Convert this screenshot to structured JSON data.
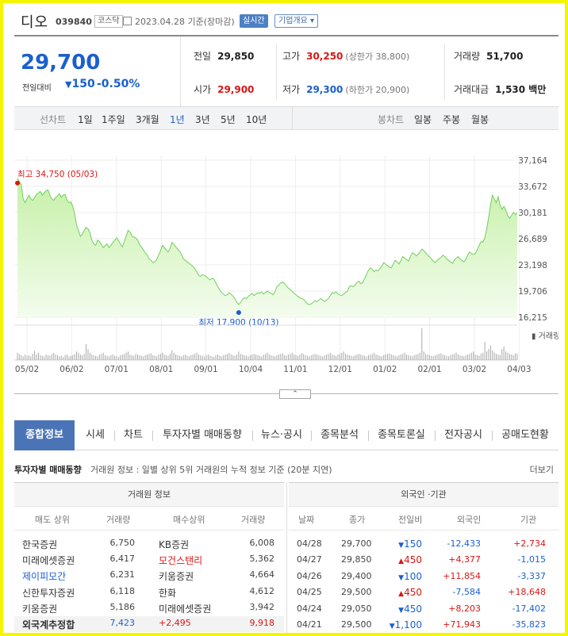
{
  "header": {
    "name": "디오",
    "code": "039840",
    "market": "코스닥",
    "date": "2023.04.28 기준(장마감)",
    "realtime_label": "실시간",
    "company_label": "기업개요"
  },
  "price": {
    "current": "29,700",
    "change_label": "전일대비",
    "change": "150",
    "change_pct": "-0.50%"
  },
  "stats": {
    "prev_label": "전일",
    "prev": "29,850",
    "high_label": "고가",
    "high": "30,250",
    "upper_limit": "(상한가 38,800)",
    "volume_label": "거래량",
    "volume": "51,700",
    "open_label": "시가",
    "open": "29,900",
    "low_label": "저가",
    "low": "29,300",
    "lower_limit": "(하한가 20,900)",
    "value_label": "거래대금",
    "value": "1,530 백만"
  },
  "chart_toolbar": {
    "line_label": "선차트",
    "line_periods": [
      "1일",
      "1주일",
      "3개월",
      "1년",
      "3년",
      "5년",
      "10년"
    ],
    "active_period": "1년",
    "candle_label": "봉차트",
    "candle_periods": [
      "일봉",
      "주봉",
      "월봉"
    ]
  },
  "chart_data": {
    "type": "area",
    "y_ticks": [
      "37,164",
      "33,672",
      "30,181",
      "26,689",
      "23,198",
      "19,706",
      "16,215"
    ],
    "ylim": [
      16215,
      37164
    ],
    "x_ticks": [
      "05/02",
      "06/02",
      "07/01",
      "08/01",
      "09/01",
      "10/04",
      "11/01",
      "12/01",
      "01/02",
      "02/01",
      "03/02",
      "04/03"
    ],
    "high_annotation": "최고 34,750 (05/03)",
    "low_annotation": "최저 17,900 (10/13)",
    "volume_label": "거래량",
    "series": [
      {
        "values": [
          34750,
          34300,
          33900,
          32000,
          31500,
          32000,
          32500,
          32000,
          31800,
          32200,
          32600,
          32800,
          33000,
          32500,
          32800,
          33100,
          33200,
          32500,
          32000,
          31800,
          32200,
          32400,
          32700,
          32200,
          32500,
          32600,
          31800,
          31500,
          31600,
          31000,
          30000,
          28500,
          27800,
          27000,
          27300,
          27800,
          28200,
          28000,
          27500,
          26500,
          26000,
          25800,
          26500,
          26300,
          25900,
          25500,
          25800,
          26000,
          25500,
          25800,
          26200,
          26500,
          26800,
          26400,
          26000,
          25600,
          26300,
          27000,
          27800,
          27600,
          27100,
          26900,
          26800,
          26500,
          25900,
          25600,
          25200,
          24800,
          24500,
          24000,
          23800,
          23500,
          23600,
          23900,
          24500,
          25100,
          25800,
          25500,
          25200,
          24900,
          25400,
          26200,
          25900,
          25600,
          25300,
          25000,
          24600,
          24000,
          23800,
          23600,
          23400,
          23200,
          23000,
          22700,
          22300,
          21800,
          21700,
          21900,
          21800,
          21600,
          21400,
          21200,
          21400,
          21300,
          20800,
          20300,
          19900,
          19500,
          19300,
          19100,
          19200,
          19500,
          19300,
          19000,
          18700,
          18200,
          17900,
          18200,
          18600,
          18800,
          18700,
          19000,
          19200,
          19400,
          19100,
          19300,
          19500,
          19400,
          19600,
          19300,
          19500,
          19700,
          19500,
          19400,
          19200,
          19600,
          20300,
          20500,
          20800,
          20900,
          20700,
          20400,
          20100,
          19900,
          19700,
          19400,
          19200,
          19000,
          18800,
          18700,
          18600,
          18300,
          18000,
          17900,
          18000,
          18200,
          18400,
          18300,
          18500,
          18700,
          18500,
          18300,
          18500,
          18700,
          19100,
          19500,
          19400,
          19600,
          19300,
          19200,
          19100,
          19300,
          19500,
          19700,
          20300,
          20400,
          20300,
          20500,
          20900,
          21000,
          20700,
          20800,
          21400,
          21900,
          22500,
          22800,
          22600,
          22300,
          22500,
          22400,
          22700,
          23000,
          23500,
          23300,
          23100,
          22900,
          22800,
          23300,
          23800,
          23600,
          23300,
          23800,
          24300,
          24100,
          23900,
          23700,
          24300,
          24800,
          24700,
          24400,
          24600,
          24900,
          25300,
          25100,
          24800,
          24500,
          24300,
          24000,
          23700,
          23500,
          23800,
          24000,
          24200,
          24500,
          24300,
          24000,
          23800,
          23600,
          23400,
          23800,
          24100,
          24300,
          24000,
          23800,
          23600,
          23900,
          24500,
          24900,
          24700,
          24600,
          24700,
          25200,
          25800,
          26300,
          26200,
          26800,
          28000,
          29500,
          31200,
          32500,
          32000,
          31500,
          32300,
          31200,
          30600,
          31000,
          30500,
          29800,
          29400,
          29800,
          30200,
          29900,
          30181
        ]
      }
    ],
    "volume_values": [
      12,
      10,
      8,
      6,
      9,
      7,
      8,
      6,
      10,
      15,
      9,
      12,
      8,
      7,
      6,
      9,
      8,
      7,
      10,
      12,
      9,
      8,
      6,
      7,
      5,
      8,
      9,
      6,
      7,
      8,
      10,
      14,
      12,
      9,
      8,
      10,
      26,
      18,
      12,
      9,
      8,
      7,
      6,
      9,
      10,
      12,
      8,
      7,
      6,
      8,
      9,
      7,
      6,
      5,
      8,
      9,
      10,
      12,
      14,
      9,
      8,
      7,
      10,
      9,
      8,
      7,
      6,
      8,
      9,
      10,
      11,
      8,
      7,
      6,
      9,
      10,
      12,
      9,
      8,
      7,
      10,
      16,
      12,
      9,
      8,
      7,
      6,
      8,
      9,
      7,
      6,
      8,
      9,
      10,
      12,
      9,
      8,
      7,
      6,
      8,
      9,
      7,
      6,
      5,
      8,
      9,
      7,
      6,
      8,
      9,
      10,
      12,
      9,
      8,
      7,
      9,
      14,
      10,
      9,
      8,
      7,
      6,
      8,
      9,
      10,
      9,
      8,
      7,
      6,
      9,
      10,
      12,
      9,
      8,
      7,
      6,
      8,
      9,
      10,
      11,
      8,
      7,
      9,
      10,
      12,
      9,
      8,
      7,
      9,
      11,
      10,
      8,
      7,
      6,
      8,
      9,
      10,
      9,
      8,
      7,
      6,
      8,
      9,
      10,
      12,
      9,
      8,
      7,
      9,
      10,
      12,
      14,
      10,
      9,
      8,
      7,
      6,
      8,
      9,
      10,
      9,
      8,
      7,
      6,
      8,
      9,
      10,
      12,
      9,
      8,
      7,
      6,
      8,
      9,
      10,
      11,
      9,
      8,
      7,
      6,
      8,
      9,
      10,
      12,
      9,
      8,
      7,
      6,
      8,
      9,
      10,
      12,
      52,
      14,
      10,
      9,
      8,
      7,
      6,
      8,
      9,
      10,
      11,
      9,
      8,
      7,
      6,
      8,
      9,
      10,
      12,
      9,
      8,
      7,
      6,
      8,
      9,
      10,
      12,
      14,
      9,
      8,
      7,
      10,
      12,
      30,
      14,
      18,
      24,
      16,
      12,
      10,
      9,
      8,
      18,
      22,
      14,
      12,
      10,
      9,
      8,
      11,
      10
    ]
  },
  "fold_button": "⌃",
  "tabs": [
    "종합정보",
    "시세",
    "차트",
    "투자자별 매매동향",
    "뉴스·공시",
    "종목분석",
    "종목토론실",
    "전자공시",
    "공매도현황"
  ],
  "section": {
    "title": "투자자별 매매동향",
    "desc": "거래원 정보 : 일별 상위 5위 거래원의 누적 정보 기준 (20분 지연)",
    "more": "더보기"
  },
  "broker_table": {
    "title": "거래원 정보",
    "headers": [
      "매도 상위",
      "거래량",
      "매수상위",
      "거래량"
    ],
    "rows": [
      {
        "sell": "한국증권",
        "sell_vol": "6,750",
        "buy": "KB증권",
        "buy_vol": "6,008",
        "sell_color": "",
        "buy_color": ""
      },
      {
        "sell": "미래에셋증권",
        "sell_vol": "6,417",
        "buy": "모건스탠리",
        "buy_vol": "5,362",
        "sell_color": "",
        "buy_color": "red"
      },
      {
        "sell": "제이피모간",
        "sell_vol": "6,231",
        "buy": "키움증권",
        "buy_vol": "4,664",
        "sell_color": "blue",
        "buy_color": ""
      },
      {
        "sell": "신한투자증권",
        "sell_vol": "6,118",
        "buy": "한화",
        "buy_vol": "4,612",
        "sell_color": "",
        "buy_color": ""
      },
      {
        "sell": "키움증권",
        "sell_vol": "5,186",
        "buy": "미래에셋증권",
        "buy_vol": "3,942",
        "sell_color": "",
        "buy_color": ""
      }
    ],
    "total": {
      "label": "외국계추정합",
      "sell_vol": "7,423",
      "diff": "+2,495",
      "buy_vol": "9,918"
    }
  },
  "foreign_table": {
    "title": "외국인 ·기관",
    "headers": [
      "날짜",
      "종가",
      "전일비",
      "외국인",
      "기관"
    ],
    "rows": [
      {
        "date": "04/28",
        "close": "29,700",
        "dir": "down",
        "chg": "150",
        "foreign": "-12,433",
        "inst": "+2,734"
      },
      {
        "date": "04/27",
        "close": "29,850",
        "dir": "up",
        "chg": "450",
        "foreign": "+4,377",
        "inst": "-1,015"
      },
      {
        "date": "04/26",
        "close": "29,400",
        "dir": "down",
        "chg": "100",
        "foreign": "+11,854",
        "inst": "-3,337"
      },
      {
        "date": "04/25",
        "close": "29,500",
        "dir": "up",
        "chg": "450",
        "foreign": "-7,584",
        "inst": "+18,648"
      },
      {
        "date": "04/24",
        "close": "29,050",
        "dir": "down",
        "chg": "450",
        "foreign": "+8,203",
        "inst": "-17,402"
      },
      {
        "date": "04/21",
        "close": "29,500",
        "dir": "down",
        "chg": "1,100",
        "foreign": "+71,943",
        "inst": "-35,823"
      }
    ]
  },
  "colors": {
    "up": "#d91616",
    "down": "#1a5fcf",
    "accent": "#4b74b6",
    "area": "#c6f0a8",
    "line": "#6fd05a",
    "border": "#f5f500"
  }
}
